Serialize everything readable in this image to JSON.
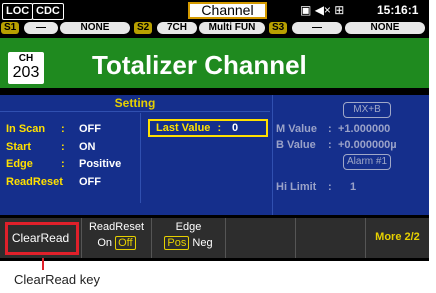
{
  "status": {
    "loc": "LOC",
    "cdc": "CDC",
    "menu_title": "Channel",
    "time": "15:16:1"
  },
  "slots": {
    "s1": {
      "id": "S1",
      "dash": "—",
      "module": "NONE"
    },
    "s2": {
      "id": "S2",
      "channels": "7CH",
      "module": "Multi FUN"
    },
    "s3": {
      "id": "S3",
      "dash": "—",
      "module": "NONE"
    }
  },
  "channel": {
    "label": "CH",
    "number": "203",
    "title": "Totalizer Channel"
  },
  "setting": {
    "header": "Setting",
    "rows": [
      {
        "key": "In Scan",
        "sep": ":",
        "value": "OFF"
      },
      {
        "key": "Start",
        "sep": ":",
        "value": "ON"
      },
      {
        "key": "Edge",
        "sep": ":",
        "value": "Positive"
      },
      {
        "key": "ReadReset",
        "sep": ":",
        "value": "OFF"
      }
    ],
    "last_value": {
      "key": "Last Value",
      "sep": ":",
      "value": "0"
    }
  },
  "right_panel": {
    "mxb": "MX+B",
    "m_value": {
      "key": "M Value",
      "sep": ":",
      "value": "+1.000000"
    },
    "b_value": {
      "key": "B Value",
      "sep": ":",
      "value": "+0.000000µ"
    },
    "alarm": "Alarm #1",
    "hi_limit": {
      "key": "Hi Limit",
      "sep": ":",
      "value": "1"
    }
  },
  "softkeys": {
    "clearread": "ClearRead",
    "readreset": {
      "label": "ReadReset",
      "on": "On",
      "off": "Off"
    },
    "edge": {
      "label": "Edge",
      "pos": "Pos",
      "neg": "Neg"
    },
    "more": "More 2/2"
  },
  "callout": "ClearRead key",
  "colors": {
    "accent_yellow": "#ffe000",
    "highlight_red": "#e0202a",
    "title_green": "#1f8a1f",
    "panel_blue": "#152f8c"
  }
}
